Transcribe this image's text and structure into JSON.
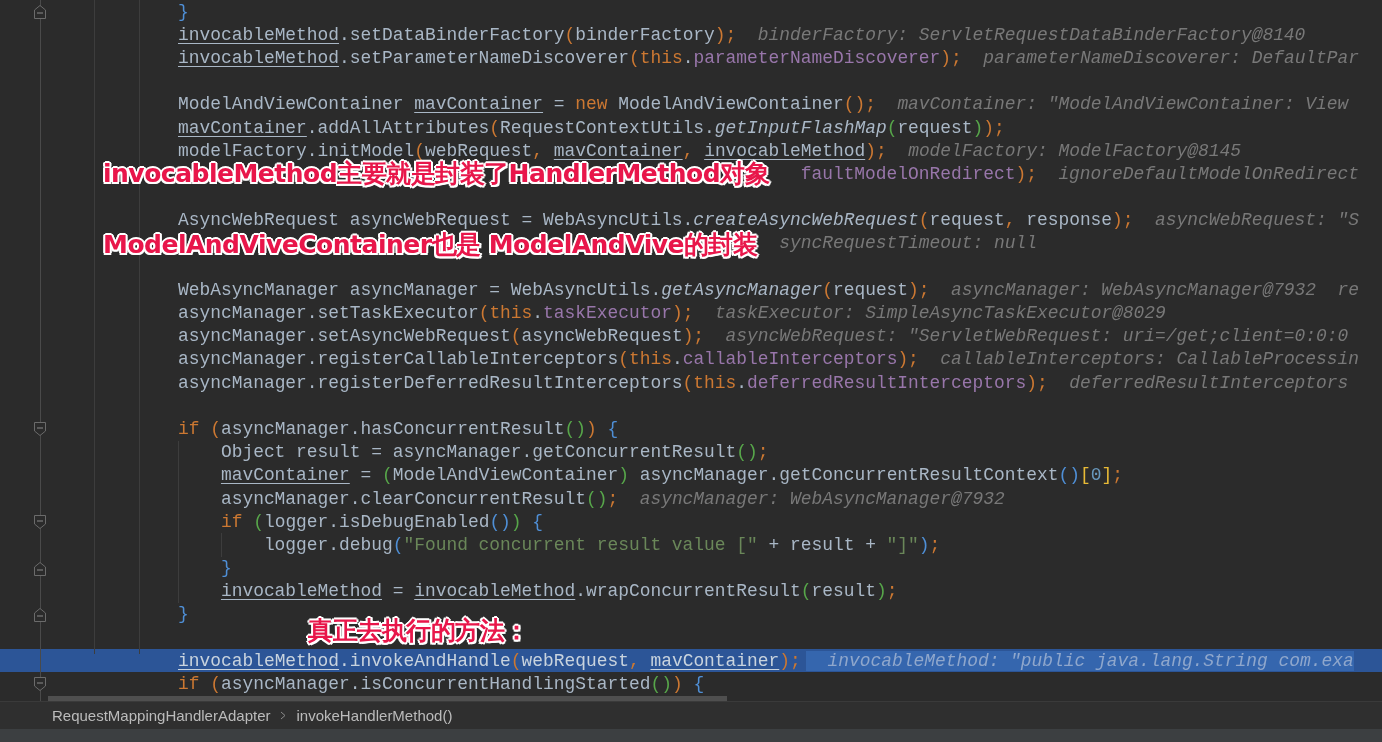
{
  "editor": {
    "lines": [
      {
        "kind": "end",
        "current": false,
        "tokens": [
          {
            "text": "}",
            "kind": "brace"
          }
        ]
      },
      {
        "kind": "code",
        "current": false,
        "tokens": [
          {
            "text": "invocableMethod",
            "kind": "var"
          },
          {
            "text": ".setDataBinderFactory",
            "kind": "plain"
          },
          {
            "text": "(",
            "kind": "punct"
          },
          {
            "text": "binderFactory",
            "kind": "plain"
          },
          {
            "text": ");",
            "kind": "punct"
          }
        ],
        "hints": [
          "binderFactory: ServletRequestDataBinderFactory@8140"
        ]
      },
      {
        "kind": "code",
        "current": false,
        "tokens": [
          {
            "text": "invocableMethod",
            "kind": "var"
          },
          {
            "text": ".setParameterNameDiscoverer",
            "kind": "plain"
          },
          {
            "text": "(",
            "kind": "punct"
          },
          {
            "text": "this",
            "kind": "keyword"
          },
          {
            "text": ".",
            "kind": "plain"
          },
          {
            "text": "parameterNameDiscoverer",
            "kind": "field"
          },
          {
            "text": ");",
            "kind": "punct"
          }
        ],
        "hints": [
          "parameterNameDiscoverer: DefaultPar"
        ]
      },
      {
        "kind": "blank",
        "current": false
      },
      {
        "kind": "code",
        "current": false,
        "tokens": [
          {
            "text": "ModelAndViewContainer ",
            "kind": "plain"
          },
          {
            "text": "mavContainer",
            "kind": "var"
          },
          {
            "text": " = ",
            "kind": "plain"
          },
          {
            "text": "new",
            "kind": "keyword"
          },
          {
            "text": " ModelAndViewContainer",
            "kind": "plain"
          },
          {
            "text": "();",
            "kind": "punct"
          }
        ],
        "hints": [
          "mavContainer: \"ModelAndViewContainer: View"
        ]
      },
      {
        "kind": "code",
        "current": false,
        "tokens": [
          {
            "text": "mavContainer",
            "kind": "var"
          },
          {
            "text": ".addAllAttributes",
            "kind": "plain"
          },
          {
            "text": "(",
            "kind": "punct"
          },
          {
            "text": "RequestContextUtils.",
            "kind": "plain"
          },
          {
            "text": "getInputFlashMap",
            "kind": "static"
          },
          {
            "text": "(",
            "kind": "nested"
          },
          {
            "text": "request",
            "kind": "plain"
          },
          {
            "text": ")",
            "kind": "nested"
          },
          {
            "text": ");",
            "kind": "punct"
          }
        ]
      },
      {
        "kind": "code",
        "current": false,
        "tokens": [
          {
            "text": "modelFactory.initModel",
            "kind": "plain"
          },
          {
            "text": "(",
            "kind": "punct"
          },
          {
            "text": "webRequest",
            "kind": "plain"
          },
          {
            "text": ", ",
            "kind": "punct"
          },
          {
            "text": "mavContainer",
            "kind": "var"
          },
          {
            "text": ", ",
            "kind": "punct"
          },
          {
            "text": "invocableMethod",
            "kind": "var"
          },
          {
            "text": ");",
            "kind": "punct"
          }
        ],
        "hints": [
          "modelFactory: ModelFactory@8145"
        ]
      },
      {
        "kind": "covered",
        "current": false,
        "tokens": [
          {
            "text": "faultModelOnRedirect",
            "kind": "field"
          },
          {
            "text": ");",
            "kind": "punct"
          }
        ],
        "hints": [
          "ignoreDefaultModelOnRedirect"
        ]
      },
      {
        "kind": "blank",
        "current": false
      },
      {
        "kind": "code",
        "current": false,
        "tokens": [
          {
            "text": "AsyncWebRequest asyncWebRequest = WebAsyncUtils.",
            "kind": "plain"
          },
          {
            "text": "createAsyncWebRequest",
            "kind": "static"
          },
          {
            "text": "(",
            "kind": "punct"
          },
          {
            "text": "request",
            "kind": "plain"
          },
          {
            "text": ", ",
            "kind": "punct"
          },
          {
            "text": "response",
            "kind": "plain"
          },
          {
            "text": ");",
            "kind": "punct"
          }
        ],
        "hints": [
          "asyncWebRequest: \"S"
        ]
      },
      {
        "kind": "covered",
        "current": false,
        "hints": [
          "syncRequestTimeout: null"
        ]
      },
      {
        "kind": "blank",
        "current": false
      },
      {
        "kind": "code",
        "current": false,
        "tokens": [
          {
            "text": "WebAsyncManager asyncManager = WebAsyncUtils.",
            "kind": "plain"
          },
          {
            "text": "getAsyncManager",
            "kind": "static"
          },
          {
            "text": "(",
            "kind": "punct"
          },
          {
            "text": "request",
            "kind": "plain"
          },
          {
            "text": ");",
            "kind": "punct"
          }
        ],
        "hints": [
          "asyncManager: WebAsyncManager@7932",
          "re"
        ]
      },
      {
        "kind": "code",
        "current": false,
        "tokens": [
          {
            "text": "asyncManager.setTaskExecutor",
            "kind": "plain"
          },
          {
            "text": "(",
            "kind": "punct"
          },
          {
            "text": "this",
            "kind": "keyword"
          },
          {
            "text": ".",
            "kind": "plain"
          },
          {
            "text": "taskExecutor",
            "kind": "field"
          },
          {
            "text": ");",
            "kind": "punct"
          }
        ],
        "hints": [
          "taskExecutor: SimpleAsyncTaskExecutor@8029"
        ]
      },
      {
        "kind": "code",
        "current": false,
        "tokens": [
          {
            "text": "asyncManager.setAsyncWebRequest",
            "kind": "plain"
          },
          {
            "text": "(",
            "kind": "punct"
          },
          {
            "text": "asyncWebRequest",
            "kind": "plain"
          },
          {
            "text": ");",
            "kind": "punct"
          }
        ],
        "hints": [
          "asyncWebRequest: \"ServletWebRequest: uri=/get;client=0:0:0"
        ]
      },
      {
        "kind": "code",
        "current": false,
        "tokens": [
          {
            "text": "asyncManager.registerCallableInterceptors",
            "kind": "plain"
          },
          {
            "text": "(",
            "kind": "punct"
          },
          {
            "text": "this",
            "kind": "keyword"
          },
          {
            "text": ".",
            "kind": "plain"
          },
          {
            "text": "callableInterceptors",
            "kind": "field"
          },
          {
            "text": ");",
            "kind": "punct"
          }
        ],
        "hints": [
          "callableInterceptors: CallableProcessin"
        ]
      },
      {
        "kind": "code",
        "current": false,
        "tokens": [
          {
            "text": "asyncManager.registerDeferredResultInterceptors",
            "kind": "plain"
          },
          {
            "text": "(",
            "kind": "punct"
          },
          {
            "text": "this",
            "kind": "keyword"
          },
          {
            "text": ".",
            "kind": "plain"
          },
          {
            "text": "deferredResultInterceptors",
            "kind": "field"
          },
          {
            "text": ");",
            "kind": "punct"
          }
        ],
        "hints": [
          "deferredResultInterceptors"
        ]
      },
      {
        "kind": "blank",
        "current": false
      },
      {
        "kind": "start",
        "current": false,
        "tokens": [
          {
            "text": "if ",
            "kind": "keyword"
          },
          {
            "text": "(",
            "kind": "punct"
          },
          {
            "text": "asyncManager.hasConcurrentResult",
            "kind": "plain"
          },
          {
            "text": "()",
            "kind": "nested"
          },
          {
            "text": ")",
            "kind": "punct"
          },
          {
            "text": " {",
            "kind": "brace"
          }
        ],
        "children": [
          {
            "kind": "code",
            "current": false,
            "tokens": [
              {
                "text": "Object result = asyncManager.getConcurrentResult",
                "kind": "plain"
              },
              {
                "text": "()",
                "kind": "nested"
              },
              {
                "text": ";",
                "kind": "punct"
              }
            ]
          },
          {
            "kind": "code",
            "current": false,
            "tokens": [
              {
                "text": "mavContainer",
                "kind": "var"
              },
              {
                "text": " = ",
                "kind": "plain"
              },
              {
                "text": "(",
                "kind": "nested"
              },
              {
                "text": "ModelAndViewContainer",
                "kind": "plain"
              },
              {
                "text": ")",
                "kind": "nested"
              },
              {
                "text": " asyncManager.getConcurrentResultContext",
                "kind": "plain"
              },
              {
                "text": "()",
                "kind": "brace"
              },
              {
                "text": "[",
                "kind": "index"
              },
              {
                "text": "0",
                "kind": "number"
              },
              {
                "text": "]",
                "kind": "index"
              },
              {
                "text": ";",
                "kind": "punct"
              }
            ]
          },
          {
            "kind": "code",
            "current": false,
            "tokens": [
              {
                "text": "asyncManager.clearConcurrentResult",
                "kind": "plain"
              },
              {
                "text": "()",
                "kind": "nested"
              },
              {
                "text": ";",
                "kind": "punct"
              }
            ],
            "hints": [
              "asyncManager: WebAsyncManager@7932"
            ]
          },
          {
            "kind": "start",
            "current": false,
            "tokens": [
              {
                "text": "if ",
                "kind": "keyword"
              },
              {
                "text": "(",
                "kind": "nested"
              },
              {
                "text": "logger.isDebugEnabled",
                "kind": "plain"
              },
              {
                "text": "()",
                "kind": "brace"
              },
              {
                "text": ")",
                "kind": "nested"
              },
              {
                "text": " {",
                "kind": "brace"
              }
            ],
            "children": [
              {
                "kind": "code",
                "current": false,
                "tokens": [
                  {
                    "text": "logger.debug",
                    "kind": "plain"
                  },
                  {
                    "text": "(",
                    "kind": "brace"
                  },
                  {
                    "text": "\"Found concurrent result value [\"",
                    "kind": "string"
                  },
                  {
                    "text": " + result + ",
                    "kind": "plain"
                  },
                  {
                    "text": "\"]\"",
                    "kind": "string"
                  },
                  {
                    "text": ")",
                    "kind": "brace"
                  },
                  {
                    "text": ";",
                    "kind": "punct"
                  }
                ]
              }
            ]
          },
          {
            "kind": "end",
            "current": false,
            "tokens": [
              {
                "text": "}",
                "kind": "brace"
              }
            ]
          },
          {
            "kind": "code",
            "current": false,
            "tokens": [
              {
                "text": "invocableMethod",
                "kind": "var"
              },
              {
                "text": " = ",
                "kind": "plain"
              },
              {
                "text": "invocableMethod",
                "kind": "var"
              },
              {
                "text": ".wrapConcurrentResult",
                "kind": "plain"
              },
              {
                "text": "(",
                "kind": "nested"
              },
              {
                "text": "result",
                "kind": "plain"
              },
              {
                "text": ")",
                "kind": "nested"
              },
              {
                "text": ";",
                "kind": "punct"
              }
            ]
          }
        ]
      },
      {
        "kind": "end",
        "current": false,
        "tokens": [
          {
            "text": "}",
            "kind": "brace"
          }
        ]
      },
      {
        "kind": "blank",
        "current": false
      },
      {
        "kind": "code",
        "current": true,
        "tokens": [
          {
            "text": "invocableMethod",
            "kind": "var"
          },
          {
            "text": ".invokeAndHandle",
            "kind": "plain"
          },
          {
            "text": "(",
            "kind": "punct"
          },
          {
            "text": "webRequest",
            "kind": "plain"
          },
          {
            "text": ", ",
            "kind": "punct"
          },
          {
            "text": "mavContainer",
            "kind": "var"
          },
          {
            "text": ");",
            "kind": "punct"
          }
        ],
        "hints": [
          "invocableMethod: \"public java.lang.String com.exa"
        ]
      },
      {
        "kind": "start",
        "current": false,
        "tokens": [
          {
            "text": "if ",
            "kind": "keyword"
          },
          {
            "text": "(",
            "kind": "punct"
          },
          {
            "text": "asyncManager.isConcurrentHandlingStarted",
            "kind": "plain"
          },
          {
            "text": "()",
            "kind": "nested"
          },
          {
            "text": ")",
            "kind": "punct"
          },
          {
            "text": " {",
            "kind": "brace"
          }
        ]
      }
    ]
  },
  "annotations": [
    "invocableMethod主要就是封装了HandlerMethod对象",
    "ModelAndViveContainer也是 ModelAndVive的封装",
    "真正去执行的方法："
  ],
  "breadcrumbs": [
    "RequestMappingHandlerAdapter",
    "invokeHandlerMethod()"
  ]
}
